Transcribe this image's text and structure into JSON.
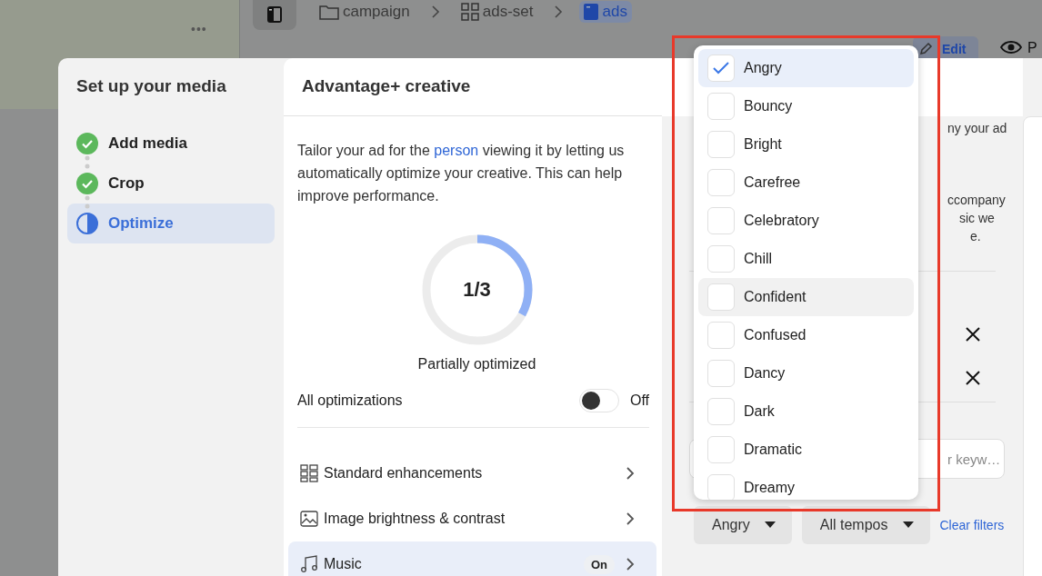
{
  "app": {
    "menu_dots": "•••",
    "breadcrumb": [
      {
        "label": "campaign",
        "kind": "folder",
        "selected": false
      },
      {
        "label": "ads-set",
        "kind": "grid",
        "selected": false
      },
      {
        "label": "ads",
        "kind": "ad",
        "selected": true
      }
    ],
    "edit_button": "Edit",
    "preview_label": "P"
  },
  "modal": {
    "nav": {
      "title": "Set up your media",
      "steps": [
        {
          "label": "Add media",
          "completed": true,
          "selected": false
        },
        {
          "label": "Crop",
          "completed": true,
          "selected": false
        },
        {
          "label": "Optimize",
          "completed": false,
          "selected": true
        }
      ]
    },
    "creative": {
      "title": "Advantage+ creative",
      "description_before": "Tailor your ad for the ",
      "description_link": "person",
      "description_after": " viewing it by letting us automatically optimize your creative. This can help improve performance.",
      "progress": {
        "reading": "1/3",
        "level": 0.33,
        "caption": "Partially optimized"
      },
      "all_optimizations": {
        "label": "All optimizations",
        "on": false,
        "state_label": "Off"
      },
      "options": [
        {
          "label": "Standard enhancements",
          "kind": "grid",
          "selected": false
        },
        {
          "label": "Image brightness & contrast",
          "kind": "image",
          "selected": false
        },
        {
          "label": "Music",
          "kind": "music",
          "selected": true,
          "badge": "On"
        }
      ]
    },
    "music": {
      "intro_fragment": "ny your ad",
      "note_fragments": [
        "ccompany",
        "sic we",
        "e."
      ],
      "tracks": [
        {
          "removable": true
        },
        {
          "removable": true
        }
      ],
      "search": {
        "placeholder": "r keyw…"
      },
      "filters": [
        {
          "label": "Angry"
        },
        {
          "label": "All tempos"
        }
      ],
      "clear_filters": "Clear filters"
    }
  },
  "mood_menu": {
    "options": [
      {
        "label": "Angry",
        "checked": true,
        "hovered": false
      },
      {
        "label": "Bouncy",
        "checked": false,
        "hovered": false
      },
      {
        "label": "Bright",
        "checked": false,
        "hovered": false
      },
      {
        "label": "Carefree",
        "checked": false,
        "hovered": false
      },
      {
        "label": "Celebratory",
        "checked": false,
        "hovered": false
      },
      {
        "label": "Chill",
        "checked": false,
        "hovered": false
      },
      {
        "label": "Confident",
        "checked": false,
        "hovered": true
      },
      {
        "label": "Confused",
        "checked": false,
        "hovered": false
      },
      {
        "label": "Dancy",
        "checked": false,
        "hovered": false
      },
      {
        "label": "Dark",
        "checked": false,
        "hovered": false
      },
      {
        "label": "Dramatic",
        "checked": false,
        "hovered": false
      },
      {
        "label": "Dreamy",
        "checked": false,
        "hovered": false
      }
    ]
  }
}
